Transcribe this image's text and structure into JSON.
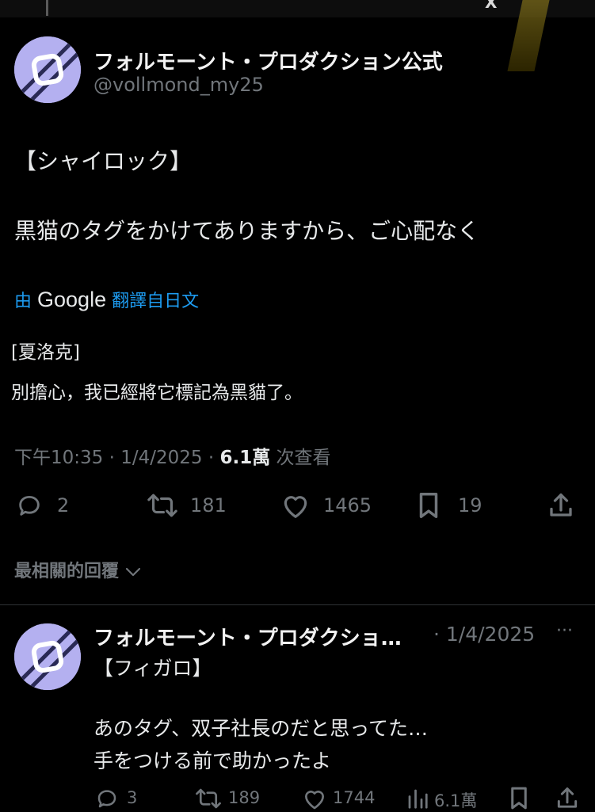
{
  "top": {
    "peek_text": "X"
  },
  "main_post": {
    "display_name": "フォルモーント・プロダクション公式",
    "handle": "@vollmond_my25",
    "body_line1": "【シャイロック】",
    "body_line2": "黒猫のタグをかけてありますから、ご心配なく",
    "translation_by": "由",
    "translation_brand": "Google",
    "translation_suffix": "翻譯自日文",
    "translated_line1": "[夏洛克]",
    "translated_line2": "別擔心，我已經將它標記為黑貓了。",
    "meta": {
      "time": "下午10:35 · 1/4/2025 · ",
      "views_count": "6.1萬",
      "views_label": " 次查看"
    },
    "stats": {
      "replies": "2",
      "reposts": "181",
      "likes": "1465",
      "bookmarks": "19"
    }
  },
  "sort": {
    "label": "最相關的回覆"
  },
  "reply": {
    "display_name": "フォルモーント・プロダクショ…",
    "date": "· 1/4/2025",
    "more": "···",
    "line1": "【フィガロ】",
    "line2": "あのタグ、双子社長のだと思ってた…",
    "line3": "手をつける前で助かったよ",
    "stats": {
      "replies": "3",
      "reposts": "189",
      "likes": "1744",
      "views": "6.1萬"
    }
  },
  "colors": {
    "background": "#000000",
    "text": "#e7e9ea",
    "muted": "#71767b",
    "link": "#1d9bf0",
    "avatar": "#b4b0f0"
  }
}
